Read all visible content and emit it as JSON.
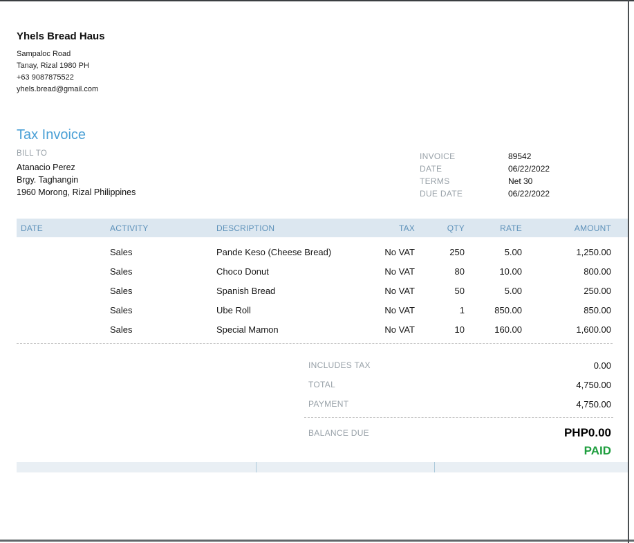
{
  "company": {
    "name": "Yhels Bread Haus",
    "address_line1": "Sampaloc Road",
    "address_line2": "Tanay, Rizal  1980 PH",
    "phone": "+63 9087875522",
    "email": "yhels.bread@gmail.com"
  },
  "document": {
    "title": "Tax Invoice"
  },
  "bill_to": {
    "label": "BILL TO",
    "name": "Atanacio Perez",
    "address_line1": "Brgy. Taghangin",
    "address_line2": "1960 Morong, Rizal Philippines"
  },
  "invoice_meta": {
    "rows": [
      {
        "label": "INVOICE",
        "value": "89542"
      },
      {
        "label": "DATE",
        "value": "06/22/2022"
      },
      {
        "label": "TERMS",
        "value": "Net 30"
      },
      {
        "label": "DUE DATE",
        "value": "06/22/2022"
      }
    ]
  },
  "line_items": {
    "columns": [
      "DATE",
      "ACTIVITY",
      "DESCRIPTION",
      "TAX",
      "QTY",
      "RATE",
      "AMOUNT"
    ],
    "rows": [
      {
        "date": "",
        "activity": "Sales",
        "description": "Pande Keso (Cheese Bread)",
        "tax": "No VAT",
        "qty": "250",
        "rate": "5.00",
        "amount": "1,250.00"
      },
      {
        "date": "",
        "activity": "Sales",
        "description": "Choco Donut",
        "tax": "No VAT",
        "qty": "80",
        "rate": "10.00",
        "amount": "800.00"
      },
      {
        "date": "",
        "activity": "Sales",
        "description": "Spanish Bread",
        "tax": "No VAT",
        "qty": "50",
        "rate": "5.00",
        "amount": "250.00"
      },
      {
        "date": "",
        "activity": "Sales",
        "description": "Ube Roll",
        "tax": "No VAT",
        "qty": "1",
        "rate": "850.00",
        "amount": "850.00"
      },
      {
        "date": "",
        "activity": "Sales",
        "description": "Special Mamon",
        "tax": "No VAT",
        "qty": "10",
        "rate": "160.00",
        "amount": "1,600.00"
      }
    ]
  },
  "totals": {
    "rows": [
      {
        "label": "INCLUDES TAX",
        "value": "0.00"
      },
      {
        "label": "TOTAL",
        "value": "4,750.00"
      },
      {
        "label": "PAYMENT",
        "value": "4,750.00"
      }
    ],
    "balance_due_label": "BALANCE DUE",
    "balance_due_value": "PHP0.00",
    "status": "PAID"
  },
  "colors": {
    "accent_blue": "#4ba0d6",
    "table_header_bg": "#dce7f0",
    "table_header_text": "#5e92ba",
    "muted_label": "#98a1a8",
    "paid_green": "#1e9e3e"
  }
}
